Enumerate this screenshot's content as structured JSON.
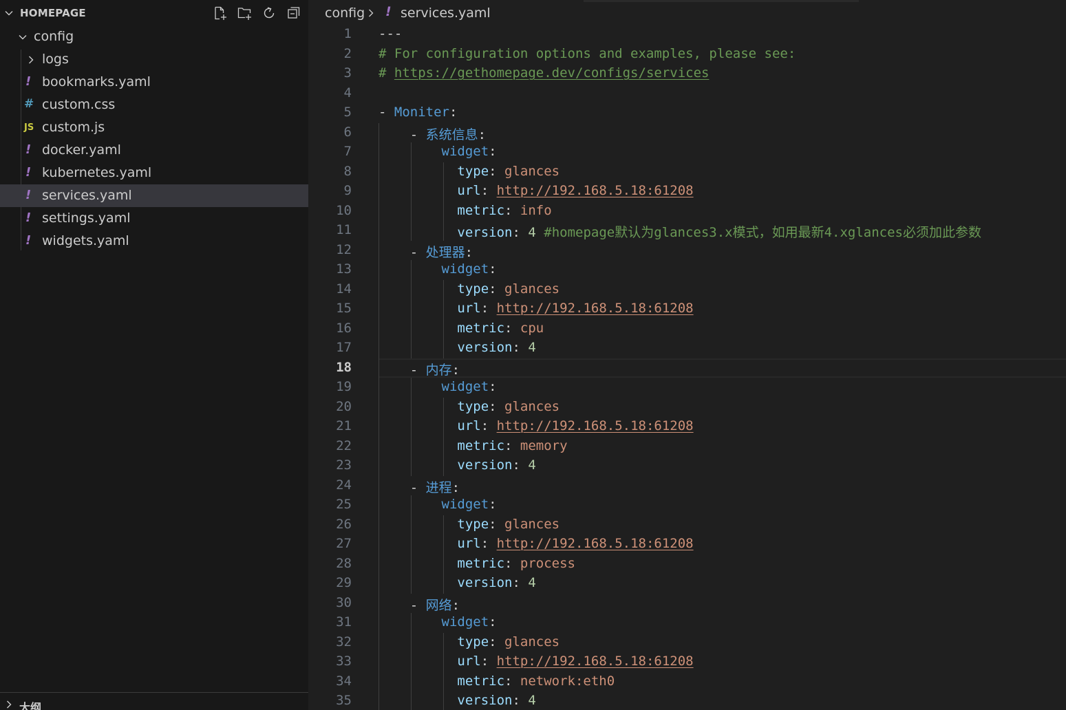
{
  "explorer": {
    "title": "HOMEPAGE",
    "actions": [
      {
        "icon": "new-file-icon"
      },
      {
        "icon": "new-folder-icon"
      },
      {
        "icon": "refresh-icon"
      },
      {
        "icon": "collapse-all-icon"
      }
    ],
    "tree": [
      {
        "label": "config",
        "type": "folder-open",
        "depth": 1
      },
      {
        "label": "logs",
        "type": "folder-closed",
        "depth": 2
      },
      {
        "label": "bookmarks.yaml",
        "type": "yaml",
        "depth": 2
      },
      {
        "label": "custom.css",
        "type": "css",
        "depth": 2
      },
      {
        "label": "custom.js",
        "type": "js",
        "depth": 2
      },
      {
        "label": "docker.yaml",
        "type": "yaml",
        "depth": 2
      },
      {
        "label": "kubernetes.yaml",
        "type": "yaml",
        "depth": 2
      },
      {
        "label": "services.yaml",
        "type": "yaml",
        "depth": 2,
        "selected": true
      },
      {
        "label": "settings.yaml",
        "type": "yaml",
        "depth": 2
      },
      {
        "label": "widgets.yaml",
        "type": "yaml",
        "depth": 2
      }
    ],
    "icon_glyphs": {
      "yaml": "!",
      "css": "#",
      "js": "JS"
    },
    "outline_title": "大纲"
  },
  "breadcrumb": {
    "folder": "config",
    "file": "services.yaml",
    "file_icon": "!"
  },
  "editor": {
    "current_line": 18,
    "lines": [
      {
        "n": "1",
        "guides": 0,
        "tokens": [
          [
            "p",
            "---"
          ]
        ]
      },
      {
        "n": "2",
        "guides": 0,
        "tokens": [
          [
            "c",
            "# For configuration options and examples, please see:"
          ]
        ]
      },
      {
        "n": "3",
        "guides": 0,
        "tokens": [
          [
            "c",
            "# "
          ],
          [
            "cu",
            "https://gethomepage.dev/configs/services"
          ]
        ]
      },
      {
        "n": "4",
        "guides": 0,
        "tokens": []
      },
      {
        "n": "5",
        "guides": 0,
        "tokens": [
          [
            "p",
            "- "
          ],
          [
            "k",
            "Moniter"
          ],
          [
            "p",
            ":"
          ]
        ]
      },
      {
        "n": "6",
        "guides": 1,
        "tokens": [
          [
            "p",
            "    - "
          ],
          [
            "k",
            "系统信息"
          ],
          [
            "p",
            ":"
          ]
        ]
      },
      {
        "n": "7",
        "guides": 2,
        "tokens": [
          [
            "p",
            "        "
          ],
          [
            "k",
            "widget"
          ],
          [
            "p",
            ":"
          ]
        ]
      },
      {
        "n": "8",
        "guides": 3,
        "tokens": [
          [
            "p",
            "          "
          ],
          [
            "k2",
            "type"
          ],
          [
            "p",
            ": "
          ],
          [
            "s",
            "glances"
          ]
        ]
      },
      {
        "n": "9",
        "guides": 3,
        "tokens": [
          [
            "p",
            "          "
          ],
          [
            "k2",
            "url"
          ],
          [
            "p",
            ": "
          ],
          [
            "su",
            "http://192.168.5.18:61208"
          ]
        ]
      },
      {
        "n": "10",
        "guides": 3,
        "tokens": [
          [
            "p",
            "          "
          ],
          [
            "k2",
            "metric"
          ],
          [
            "p",
            ": "
          ],
          [
            "s",
            "info"
          ]
        ]
      },
      {
        "n": "11",
        "guides": 3,
        "tokens": [
          [
            "p",
            "          "
          ],
          [
            "k2",
            "version"
          ],
          [
            "p",
            ": "
          ],
          [
            "n",
            "4"
          ],
          [
            "p",
            " "
          ],
          [
            "c",
            "#homepage默认为glances3.x模式，如用最新4.xglances必须加此参数"
          ]
        ]
      },
      {
        "n": "12",
        "guides": 1,
        "tokens": [
          [
            "p",
            "    - "
          ],
          [
            "k",
            "处理器"
          ],
          [
            "p",
            ":"
          ]
        ]
      },
      {
        "n": "13",
        "guides": 2,
        "tokens": [
          [
            "p",
            "        "
          ],
          [
            "k",
            "widget"
          ],
          [
            "p",
            ":"
          ]
        ]
      },
      {
        "n": "14",
        "guides": 3,
        "tokens": [
          [
            "p",
            "          "
          ],
          [
            "k2",
            "type"
          ],
          [
            "p",
            ": "
          ],
          [
            "s",
            "glances"
          ]
        ]
      },
      {
        "n": "15",
        "guides": 3,
        "tokens": [
          [
            "p",
            "          "
          ],
          [
            "k2",
            "url"
          ],
          [
            "p",
            ": "
          ],
          [
            "su",
            "http://192.168.5.18:61208"
          ]
        ]
      },
      {
        "n": "16",
        "guides": 3,
        "tokens": [
          [
            "p",
            "          "
          ],
          [
            "k2",
            "metric"
          ],
          [
            "p",
            ": "
          ],
          [
            "s",
            "cpu"
          ]
        ]
      },
      {
        "n": "17",
        "guides": 3,
        "tokens": [
          [
            "p",
            "          "
          ],
          [
            "k2",
            "version"
          ],
          [
            "p",
            ": "
          ],
          [
            "n",
            "4"
          ]
        ]
      },
      {
        "n": "18",
        "guides": 1,
        "tokens": [
          [
            "p",
            "    - "
          ],
          [
            "k",
            "内存"
          ],
          [
            "p",
            ":"
          ]
        ]
      },
      {
        "n": "19",
        "guides": 2,
        "tokens": [
          [
            "p",
            "        "
          ],
          [
            "k",
            "widget"
          ],
          [
            "p",
            ":"
          ]
        ]
      },
      {
        "n": "20",
        "guides": 3,
        "tokens": [
          [
            "p",
            "          "
          ],
          [
            "k2",
            "type"
          ],
          [
            "p",
            ": "
          ],
          [
            "s",
            "glances"
          ]
        ]
      },
      {
        "n": "21",
        "guides": 3,
        "tokens": [
          [
            "p",
            "          "
          ],
          [
            "k2",
            "url"
          ],
          [
            "p",
            ": "
          ],
          [
            "su",
            "http://192.168.5.18:61208"
          ]
        ]
      },
      {
        "n": "22",
        "guides": 3,
        "tokens": [
          [
            "p",
            "          "
          ],
          [
            "k2",
            "metric"
          ],
          [
            "p",
            ": "
          ],
          [
            "s",
            "memory"
          ]
        ]
      },
      {
        "n": "23",
        "guides": 3,
        "tokens": [
          [
            "p",
            "          "
          ],
          [
            "k2",
            "version"
          ],
          [
            "p",
            ": "
          ],
          [
            "n",
            "4"
          ]
        ]
      },
      {
        "n": "24",
        "guides": 1,
        "tokens": [
          [
            "p",
            "    - "
          ],
          [
            "k",
            "进程"
          ],
          [
            "p",
            ":"
          ]
        ]
      },
      {
        "n": "25",
        "guides": 2,
        "tokens": [
          [
            "p",
            "        "
          ],
          [
            "k",
            "widget"
          ],
          [
            "p",
            ":"
          ]
        ]
      },
      {
        "n": "26",
        "guides": 3,
        "tokens": [
          [
            "p",
            "          "
          ],
          [
            "k2",
            "type"
          ],
          [
            "p",
            ": "
          ],
          [
            "s",
            "glances"
          ]
        ]
      },
      {
        "n": "27",
        "guides": 3,
        "tokens": [
          [
            "p",
            "          "
          ],
          [
            "k2",
            "url"
          ],
          [
            "p",
            ": "
          ],
          [
            "su",
            "http://192.168.5.18:61208"
          ]
        ]
      },
      {
        "n": "28",
        "guides": 3,
        "tokens": [
          [
            "p",
            "          "
          ],
          [
            "k2",
            "metric"
          ],
          [
            "p",
            ": "
          ],
          [
            "s",
            "process"
          ]
        ]
      },
      {
        "n": "29",
        "guides": 3,
        "tokens": [
          [
            "p",
            "          "
          ],
          [
            "k2",
            "version"
          ],
          [
            "p",
            ": "
          ],
          [
            "n",
            "4"
          ]
        ]
      },
      {
        "n": "30",
        "guides": 1,
        "tokens": [
          [
            "p",
            "    - "
          ],
          [
            "k",
            "网络"
          ],
          [
            "p",
            ":"
          ]
        ]
      },
      {
        "n": "31",
        "guides": 2,
        "tokens": [
          [
            "p",
            "        "
          ],
          [
            "k",
            "widget"
          ],
          [
            "p",
            ":"
          ]
        ]
      },
      {
        "n": "32",
        "guides": 3,
        "tokens": [
          [
            "p",
            "          "
          ],
          [
            "k2",
            "type"
          ],
          [
            "p",
            ": "
          ],
          [
            "s",
            "glances"
          ]
        ]
      },
      {
        "n": "33",
        "guides": 3,
        "tokens": [
          [
            "p",
            "          "
          ],
          [
            "k2",
            "url"
          ],
          [
            "p",
            ": "
          ],
          [
            "su",
            "http://192.168.5.18:61208"
          ]
        ]
      },
      {
        "n": "34",
        "guides": 3,
        "tokens": [
          [
            "p",
            "          "
          ],
          [
            "k2",
            "metric"
          ],
          [
            "p",
            ": "
          ],
          [
            "s",
            "network:eth0"
          ]
        ]
      },
      {
        "n": "35",
        "guides": 3,
        "tokens": [
          [
            "p",
            "          "
          ],
          [
            "k2",
            "version"
          ],
          [
            "p",
            ": "
          ],
          [
            "n",
            "4"
          ]
        ]
      }
    ]
  },
  "colors": {
    "editor_bg": "#1f1f1f",
    "sidebar_bg": "#181818",
    "selection": "#37373d",
    "key": "#569cd6",
    "property": "#9cdcfe",
    "string": "#ce9178",
    "number": "#b5cea8",
    "comment": "#6a9955",
    "yaml_icon": "#a074c4"
  }
}
